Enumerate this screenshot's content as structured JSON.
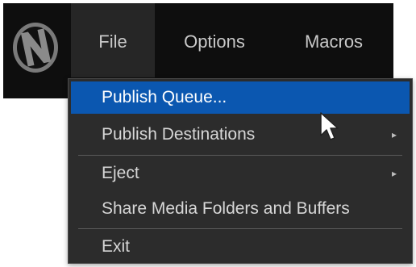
{
  "menubar": {
    "logo_icon": "newtek-n-logo-icon",
    "tabs": [
      {
        "label": "File",
        "active": true
      },
      {
        "label": "Options",
        "active": false
      },
      {
        "label": "Macros",
        "active": false
      }
    ]
  },
  "file_menu": {
    "items": [
      {
        "label": "Publish Queue...",
        "highlighted": true,
        "submenu": false
      },
      {
        "label": "Publish Destinations",
        "highlighted": false,
        "submenu": true
      },
      {
        "label": "Eject",
        "highlighted": false,
        "submenu": true
      },
      {
        "label": "Share Media Folders and Buffers",
        "highlighted": false,
        "submenu": false
      },
      {
        "label": "Exit",
        "highlighted": false,
        "submenu": false
      }
    ],
    "submenu_arrow": "▸"
  },
  "colors": {
    "menubar_bg": "#0e0e0e",
    "menu_bg": "#2c2c2c",
    "highlight": "#0b57b0",
    "text": "#d7d7d7"
  }
}
